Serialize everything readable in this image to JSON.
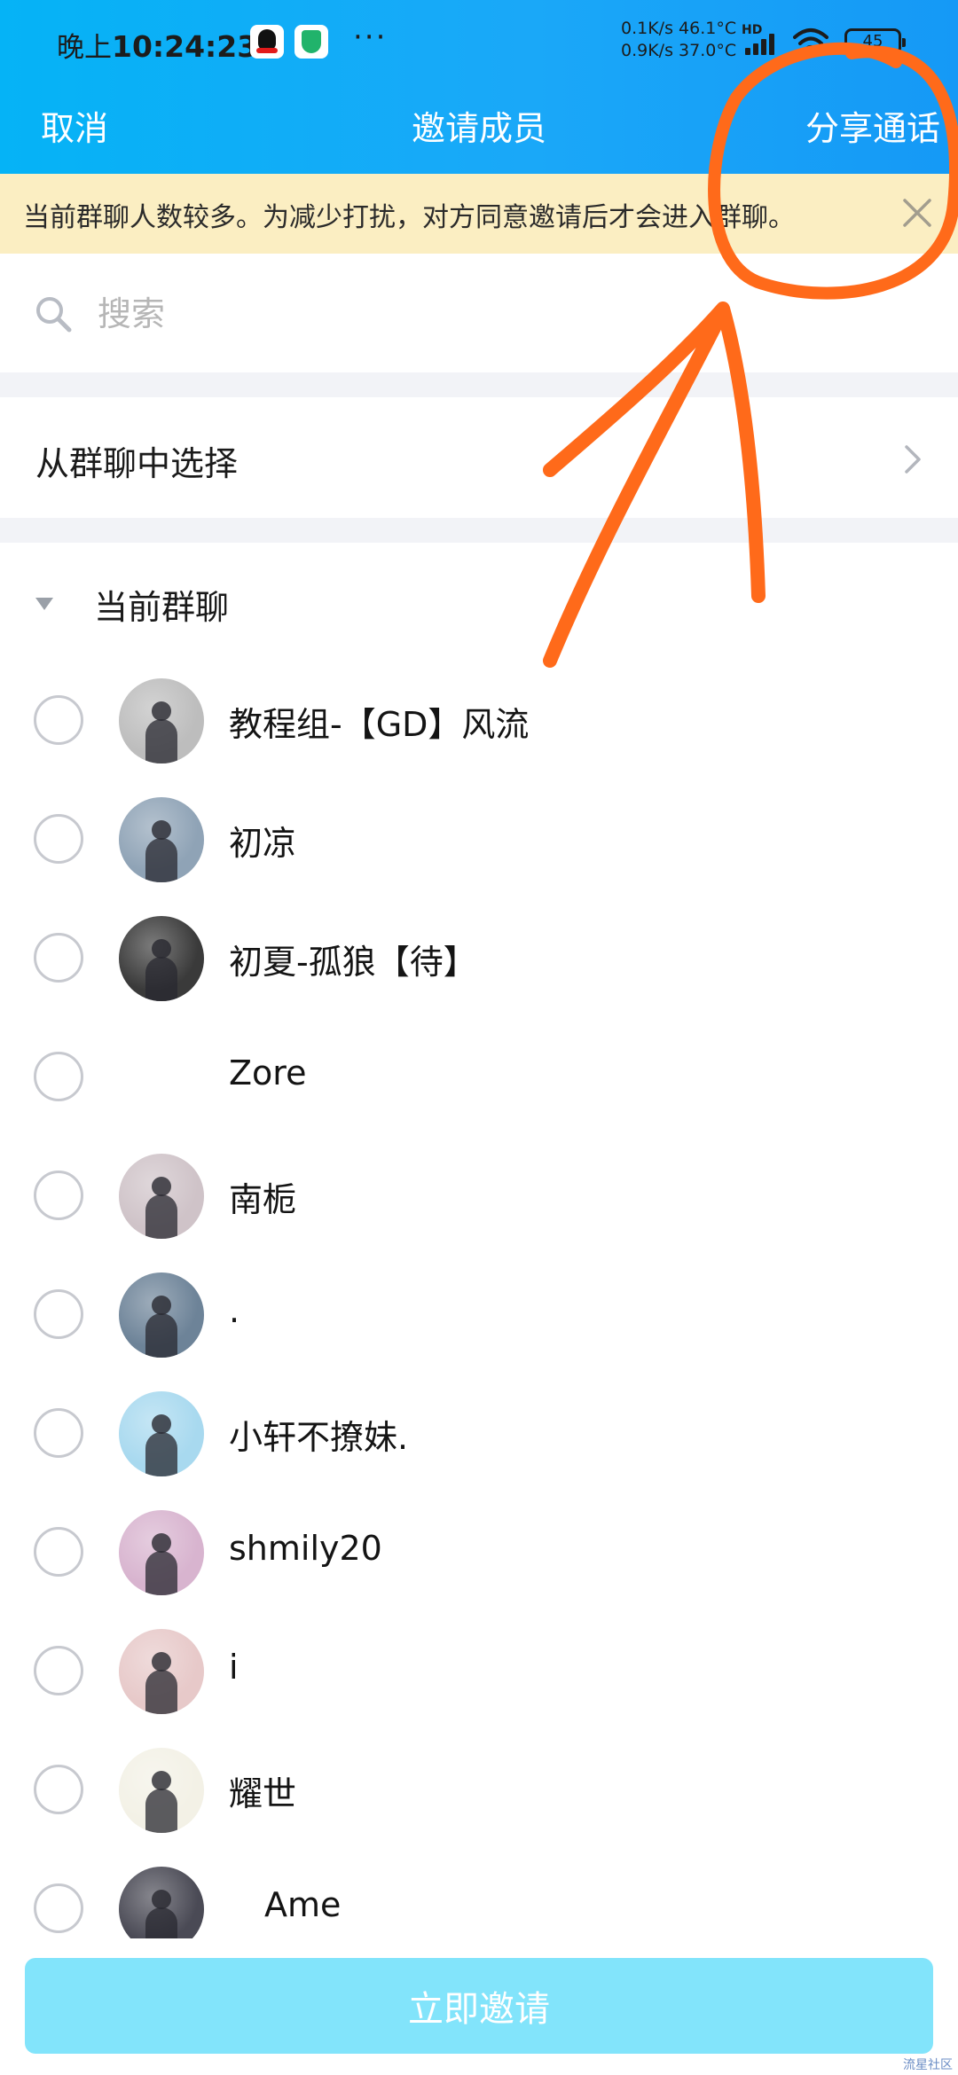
{
  "status_bar": {
    "time_prefix": "晚上",
    "time": "10:24:23",
    "dots": "···",
    "net_up": "0.1K/s 46.1°C",
    "net_down": "0.9K/s 37.0°C",
    "hd": "HD",
    "battery": "45",
    "icons": [
      "qq-icon",
      "shield-icon",
      "signal-icon",
      "wifi-icon",
      "battery-icon"
    ]
  },
  "nav": {
    "cancel_label": "取消",
    "title": "邀请成员",
    "share_label": "分享通话"
  },
  "notice": {
    "text": "当前群聊人数较多。为减少打扰，对方同意邀请后才会进入群聊。"
  },
  "search": {
    "placeholder": "搜索"
  },
  "from_group": {
    "label": "从群聊中选择"
  },
  "section": {
    "label": "当前群聊"
  },
  "members": [
    {
      "name": "教程组-【GD】风流",
      "avatar_bg": "#bdbdbd"
    },
    {
      "name": "初凉",
      "avatar_bg": "#8fa3b6"
    },
    {
      "name": "初夏-孤狼【待】",
      "avatar_bg": "#3a3a3a"
    },
    {
      "name": "Zore",
      "avatar_bg": ""
    },
    {
      "name": "南栀",
      "avatar_bg": "#cfc3c8"
    },
    {
      "name": ".",
      "avatar_bg": "#6d8398"
    },
    {
      "name": "小轩不撩妹.",
      "avatar_bg": "#a8d9ef"
    },
    {
      "name": "shmily20",
      "avatar_bg": "#d8b4cf"
    },
    {
      "name": "i",
      "avatar_bg": "#e7c9c9"
    },
    {
      "name": "耀世",
      "avatar_bg": "#f3f1e6"
    },
    {
      "name": "Ame",
      "avatar_bg": "#4a4a55"
    }
  ],
  "bottom": {
    "invite_label": "立即邀请",
    "watermark": "流星社区"
  },
  "colors": {
    "header_blue": "#05b3f6",
    "notice_bg": "#fbeec2",
    "invite_btn": "#82e4fb",
    "annotation_orange": "#ff6a1a"
  }
}
